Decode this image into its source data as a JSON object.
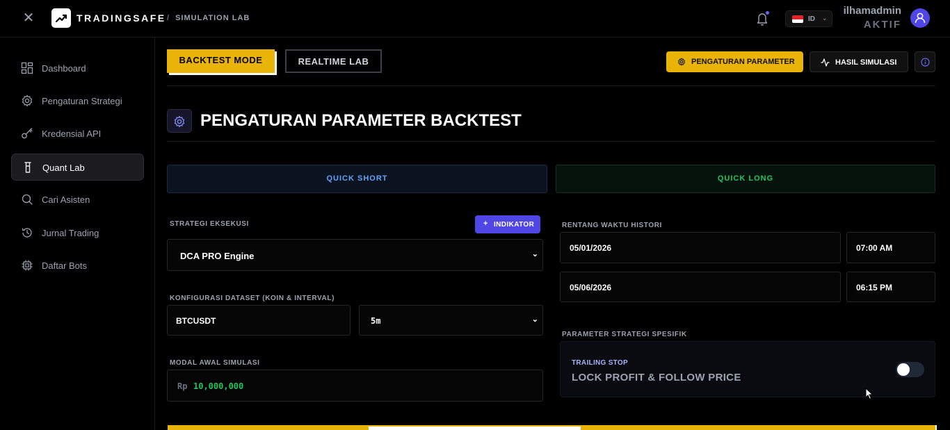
{
  "topbar": {
    "brand": "TRADINGSAFE",
    "breadcrumb_sep": "/",
    "breadcrumb": "SIMULATION LAB",
    "lang_code": "ID",
    "username": "ilhamadmin",
    "user_status": "AKTIF"
  },
  "sidebar": {
    "items": [
      {
        "label": "Dashboard",
        "icon": "dashboard-icon"
      },
      {
        "label": "Pengaturan Strategi",
        "icon": "gear-icon"
      },
      {
        "label": "Kredensial API",
        "icon": "key-icon"
      },
      {
        "label": "Quant Lab",
        "icon": "flask-icon",
        "active": true
      },
      {
        "label": "Cari Asisten",
        "icon": "search-icon"
      },
      {
        "label": "Jurnal Trading",
        "icon": "history-icon"
      },
      {
        "label": "Daftar Bots",
        "icon": "cpu-icon"
      }
    ]
  },
  "toolbar": {
    "backtest_mode": "BACKTEST MODE",
    "realtime_lab": "REALTIME LAB",
    "param_button": "PENGATURAN PARAMETER",
    "sim_button": "HASIL SIMULASI"
  },
  "page": {
    "title": "PENGATURAN PARAMETER BACKTEST",
    "quick_short": "QUICK SHORT",
    "quick_long": "QUICK LONG"
  },
  "form": {
    "strategy_label": "STRATEGI EKSEKUSI",
    "indikator_button": "INDIKATOR",
    "strategy_value": "DCA PRO Engine",
    "dataset_label": "KONFIGURASI DATASET (KOIN & INTERVAL)",
    "coin_value": "BTCUSDT",
    "interval_value": "5m",
    "capital_label": "MODAL AWAL SIMULASI",
    "capital_prefix": "Rp",
    "capital_value": "10,000,000",
    "range_label": "RENTANG WAKTU HISTORI",
    "start_date": "05/01/2026",
    "start_time": "07:00 AM",
    "end_date": "05/06/2026",
    "end_time": "06:15 PM",
    "specific_label": "PARAMETER STRATEGI SPESIFIK",
    "trailing_tag": "TRAILING STOP",
    "trailing_title": "LOCK PROFIT & FOLLOW PRICE",
    "trailing_enabled": false
  },
  "colors": {
    "accent": "#eab308",
    "primary": "#4f46e5",
    "short": "#60a5fa",
    "long": "#22c55e"
  }
}
